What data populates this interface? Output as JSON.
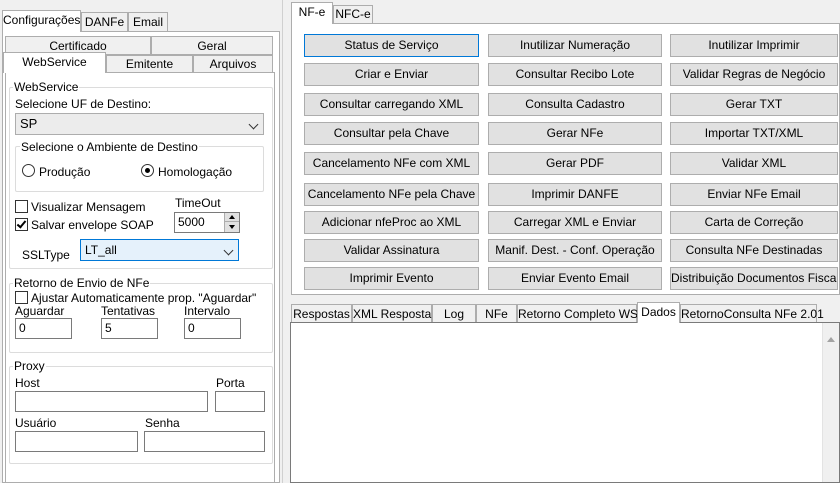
{
  "left": {
    "top_tabs": [
      "Configurações",
      "DANFe",
      "Email"
    ],
    "sub_tabs_row1": [
      "Certificado",
      "Geral"
    ],
    "sub_tabs_row2": [
      "WebService",
      "Emitente",
      "Arquivos"
    ],
    "webservice": {
      "group_title": "WebService",
      "uf_label": "Selecione UF de Destino:",
      "uf_value": "SP",
      "ambiente_title": "Selecione o Ambiente de Destino",
      "producao_label": "Produção",
      "homologacao_label": "Homologação",
      "selected_ambiente": "Homologação",
      "visualizar_label": "Visualizar Mensagem",
      "visualizar_checked": false,
      "salvar_label": "Salvar envelope SOAP",
      "salvar_checked": true,
      "timeout_label": "TimeOut",
      "timeout_value": "5000",
      "ssltype_label": "SSLType",
      "ssltype_value": "LT_all"
    },
    "retorno": {
      "group_title": "Retorno de Envio de NFe",
      "ajustar_label": "Ajustar Automaticamente prop. \"Aguardar\"",
      "ajustar_checked": false,
      "aguardar_label": "Aguardar",
      "aguardar_value": "0",
      "tentativas_label": "Tentativas",
      "tentativas_value": "5",
      "intervalo_label": "Intervalo",
      "intervalo_value": "0"
    },
    "proxy": {
      "group_title": "Proxy",
      "host_label": "Host",
      "host_value": "",
      "porta_label": "Porta",
      "porta_value": "",
      "usuario_label": "Usuário",
      "usuario_value": "",
      "senha_label": "Senha",
      "senha_value": ""
    }
  },
  "right": {
    "tabs": [
      "NF-e",
      "NFC-e"
    ],
    "buttons": [
      [
        "Status de Serviço",
        "Inutilizar Numeração",
        "Inutilizar Imprimir"
      ],
      [
        "Criar e Enviar",
        "Consultar Recibo Lote",
        "Validar Regras de Negócio"
      ],
      [
        "Consultar carregando XML",
        "Consulta Cadastro",
        "Gerar TXT"
      ],
      [
        "Consultar pela Chave",
        "Gerar NFe",
        "Importar TXT/XML"
      ],
      [
        "Cancelamento NFe com XML",
        "Gerar PDF",
        "Validar XML"
      ],
      [
        "Cancelamento NFe pela Chave",
        "Imprimir DANFE",
        "Enviar NFe Email"
      ],
      [
        "Adicionar nfeProc ao XML",
        "Carregar XML e Enviar",
        "Carta de Correção"
      ],
      [
        "Validar Assinatura",
        "Manif. Dest. - Conf. Operação",
        "Consulta NFe Destinadas"
      ],
      [
        "Imprimir Evento",
        "Enviar Evento Email",
        "Distribuição Documentos Fiscais"
      ]
    ],
    "bottom_tabs": [
      "Respostas",
      "XML Resposta",
      "Log",
      "NFe",
      "Retorno Completo WS",
      "Dados",
      "RetornoConsulta NFe 2.01"
    ],
    "active_bottom_tab": "Dados",
    "dados_content": ""
  }
}
